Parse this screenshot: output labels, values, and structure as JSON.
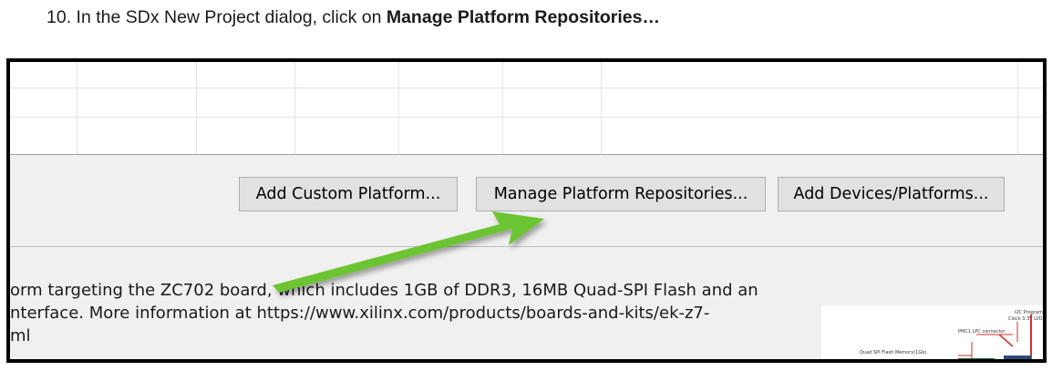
{
  "instruction": {
    "prefix": "10.  In the SDx New Project dialog, click on ",
    "emphasis": "Manage Platform Repositories…"
  },
  "dialog": {
    "buttons": {
      "add_custom_platform": "Add Custom Platform...",
      "manage_platform_repositories": "Manage Platform Repositories...",
      "add_devices_platforms": "Add Devices/Platforms..."
    },
    "description": {
      "line1": "orm targeting the ZC702 board, which includes 1GB of DDR3, 16MB Quad-SPI Flash and an",
      "line2": "nterface. More information at https://www.xilinx.com/products/boards-and-kits/ek-z7-",
      "line3": "ml"
    },
    "board_image_labels": {
      "label1": "I2C Program",
      "label2": "Clock 3.3V LVDS",
      "label3": "PMC1 LPC connector",
      "label4": "Quad SPI Flash Memory(1Gb)"
    }
  },
  "annotation": {
    "arrow_color": "#6cc432",
    "arrow_icon": "green-callout-arrow"
  }
}
